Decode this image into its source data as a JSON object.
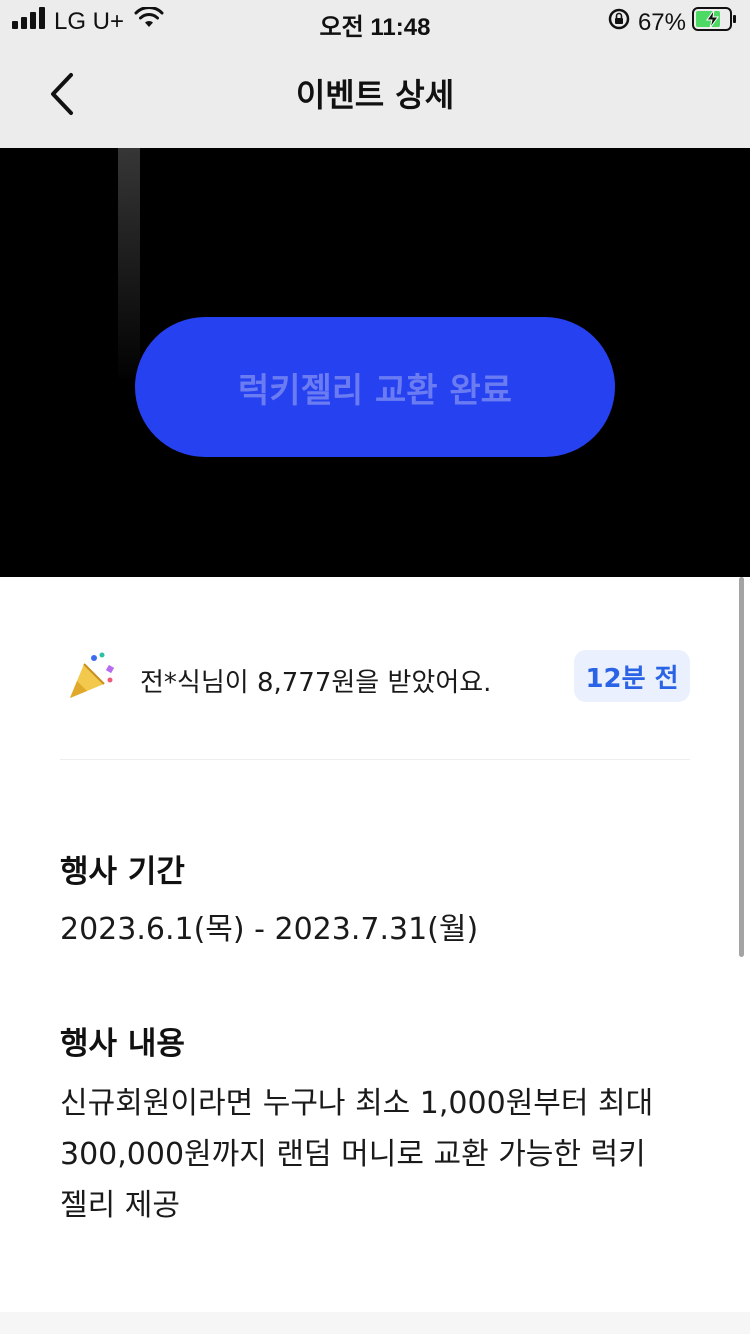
{
  "status_bar": {
    "carrier": "LG U+",
    "time": "오전 11:48",
    "battery_percent": "67%",
    "icons": [
      "signal-icon",
      "wifi-icon",
      "rotation-lock-icon",
      "battery-charging-icon"
    ]
  },
  "nav": {
    "title": "이벤트 상세",
    "back_icon": "chevron-left-icon"
  },
  "hero": {
    "button_label": "럭키젤리 교환 완료",
    "button_color": "#2641f0",
    "button_text_color": "#6b7cf2"
  },
  "notification": {
    "icon": "party-popper-icon",
    "text": "전*식님이 8,777원을 받았어요.",
    "time_badge": "12분 전",
    "badge_color": "#2b63e6"
  },
  "sections": [
    {
      "title": "행사 기간",
      "body": "2023.6.1(목) - 2023.7.31(월)"
    },
    {
      "title": "행사 내용",
      "body_lines": [
        "신규회원이라면 누구나 최소 1,000원부터 최대",
        "300,000원까지 랜덤 머니로 교환 가능한 럭키",
        "젤리 제공"
      ]
    }
  ]
}
